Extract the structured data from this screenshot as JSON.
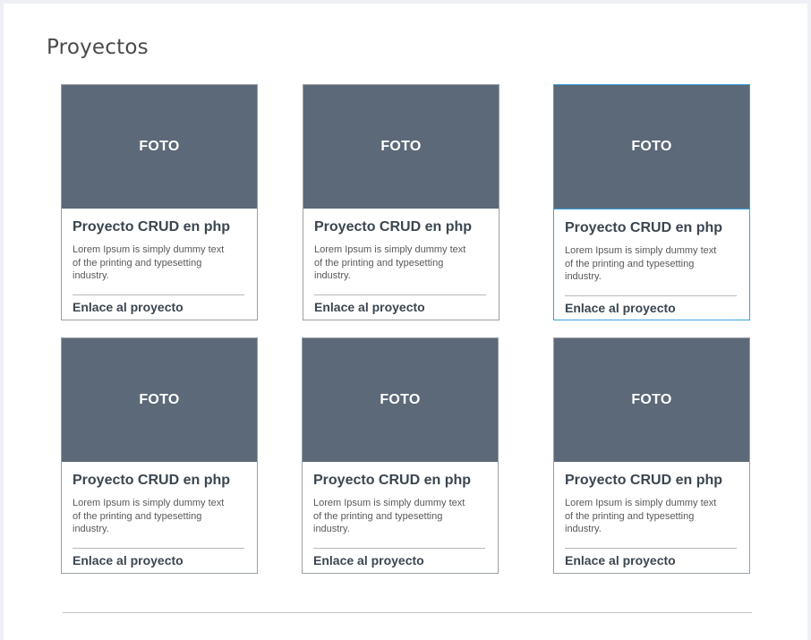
{
  "section": {
    "title": "Proyectos"
  },
  "accent_color": "#3aa0e0",
  "photo_color": "#5b6978",
  "cards": [
    {
      "photo_label": "FOTO",
      "title": "Proyecto CRUD en php",
      "description": "Lorem Ipsum is simply dummy text of the printing and typesetting industry.",
      "link_text": "Enlace al proyecto"
    },
    {
      "photo_label": "FOTO",
      "title": "Proyecto CRUD en php",
      "description": "Lorem Ipsum is simply dummy text of the printing and typesetting industry.",
      "link_text": "Enlace al proyecto"
    },
    {
      "photo_label": "FOTO",
      "title": "Proyecto CRUD en php",
      "description": "Lorem Ipsum is simply dummy text of the printing and typesetting industry.",
      "link_text": "Enlace al proyecto"
    },
    {
      "photo_label": "FOTO",
      "title": "Proyecto CRUD en php",
      "description": "Lorem Ipsum is simply dummy text of the printing and typesetting industry.",
      "link_text": "Enlace al proyecto"
    },
    {
      "photo_label": "FOTO",
      "title": "Proyecto CRUD en php",
      "description": "Lorem Ipsum is simply dummy text of the printing and typesetting industry.",
      "link_text": "Enlace al proyecto"
    },
    {
      "photo_label": "FOTO",
      "title": "Proyecto CRUD en php",
      "description": "Lorem Ipsum is simply dummy text of the printing and typesetting industry.",
      "link_text": "Enlace al proyecto"
    }
  ]
}
